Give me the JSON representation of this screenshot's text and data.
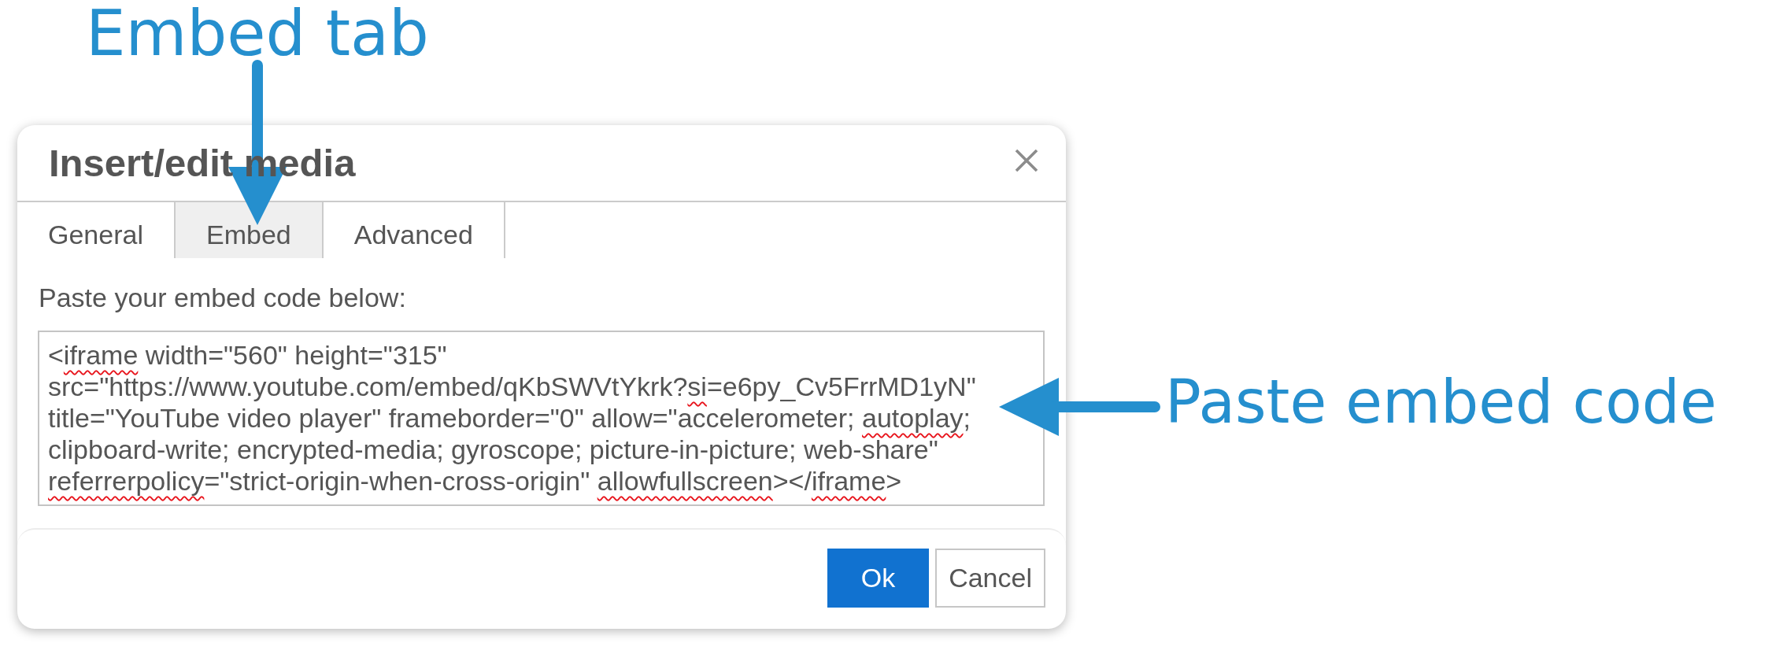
{
  "callouts": [
    {
      "kind": "down",
      "label": "Embed tab"
    },
    {
      "kind": "left",
      "label": "Paste embed code"
    }
  ],
  "dialog": {
    "title": "Insert/edit media",
    "tabs": [
      {
        "label": "General",
        "selected": false
      },
      {
        "label": "Embed",
        "selected": true
      },
      {
        "label": "Advanced",
        "selected": false
      }
    ],
    "embed_label": "Paste your embed code below:",
    "embed_code": {
      "segments": [
        {
          "text": "<",
          "misspelled": false
        },
        {
          "text": "iframe",
          "misspelled": true
        },
        {
          "text": " width=\"560\" height=\"315\" src=\"https://www.youtube.com/embed/qKbSWVtYkrk?",
          "misspelled": false
        },
        {
          "text": "si",
          "misspelled": true
        },
        {
          "text": "=e6py_Cv5FrrMD1yN\" title=\"YouTube video player\" frameborder=\"0\" allow=\"accelerometer; ",
          "misspelled": false
        },
        {
          "text": "autoplay",
          "misspelled": true
        },
        {
          "text": "; clipboard-write; encrypted-media; gyroscope; picture-in-picture; web-share\" ",
          "misspelled": false
        },
        {
          "text": "referrerpolicy",
          "misspelled": true
        },
        {
          "text": "=\"strict-origin-when-cross-origin\" ",
          "misspelled": false
        },
        {
          "text": "allowfullscreen",
          "misspelled": true
        },
        {
          "text": "></",
          "misspelled": false
        },
        {
          "text": "iframe",
          "misspelled": true
        },
        {
          "text": ">",
          "misspelled": false
        }
      ]
    },
    "buttons": [
      {
        "label": "Ok",
        "kind": "primary"
      },
      {
        "label": "Cancel",
        "kind": "secondary"
      }
    ]
  }
}
